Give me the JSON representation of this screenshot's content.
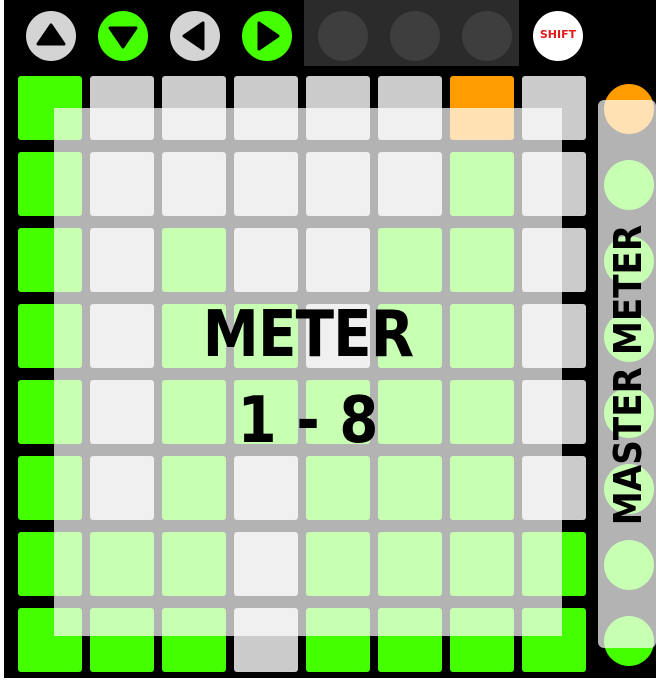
{
  "top_buttons": [
    {
      "name": "up-arrow-button",
      "icon": "arrow-up-icon",
      "fill": "#d4d4d4",
      "glyph": "#000000"
    },
    {
      "name": "down-arrow-button",
      "icon": "arrow-down-icon",
      "fill": "#44ff00",
      "glyph": "#000000"
    },
    {
      "name": "left-arrow-button",
      "icon": "arrow-left-icon",
      "fill": "#d4d4d4",
      "glyph": "#000000"
    },
    {
      "name": "right-arrow-button",
      "icon": "arrow-right-icon",
      "fill": "#44ff00",
      "glyph": "#000000"
    }
  ],
  "shift_label": "SHIFT",
  "colors": {
    "green": "#44ff00",
    "gray": "#cbcbcb",
    "orange": "#ff9c00",
    "text_red": "#e21a1a"
  },
  "grid": [
    [
      "green",
      "gray",
      "gray",
      "gray",
      "gray",
      "gray",
      "orange",
      "gray"
    ],
    [
      "green",
      "gray",
      "gray",
      "gray",
      "gray",
      "gray",
      "green",
      "gray"
    ],
    [
      "green",
      "gray",
      "green",
      "gray",
      "gray",
      "green",
      "green",
      "gray"
    ],
    [
      "green",
      "gray",
      "green",
      "green",
      "gray",
      "green",
      "green",
      "gray"
    ],
    [
      "green",
      "gray",
      "green",
      "green",
      "green",
      "green",
      "green",
      "gray"
    ],
    [
      "green",
      "gray",
      "green",
      "gray",
      "green",
      "green",
      "green",
      "gray"
    ],
    [
      "green",
      "green",
      "green",
      "gray",
      "green",
      "green",
      "green",
      "green"
    ],
    [
      "green",
      "green",
      "green",
      "gray",
      "green",
      "green",
      "green",
      "green"
    ]
  ],
  "scene_buttons": [
    "orange",
    "green",
    "green",
    "green",
    "green",
    "green",
    "green",
    "green"
  ],
  "overlay": {
    "title": "METER",
    "range": "1 - 8"
  },
  "side_overlay": {
    "label": "MASTER METER"
  }
}
